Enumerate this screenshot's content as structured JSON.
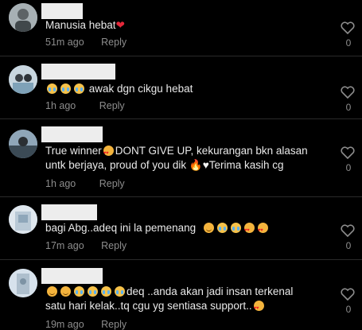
{
  "comments": [
    {
      "segments": [
        {
          "type": "text",
          "value": "Manusia hebat"
        },
        {
          "type": "icon",
          "name": "red-heart-icon"
        }
      ],
      "time": "51m ago",
      "reply": "Reply",
      "likes": "0"
    },
    {
      "segments": [
        {
          "type": "icon",
          "name": "crying-face-icon"
        },
        {
          "type": "icon",
          "name": "crying-face-icon"
        },
        {
          "type": "icon",
          "name": "crying-face-icon"
        },
        {
          "type": "text",
          "value": " awak dgn cikgu hebat"
        }
      ],
      "time": "1h ago",
      "reply": "Reply",
      "likes": "0"
    },
    {
      "lines": [
        "True winner",
        "DONT GIVE UP, kekurangan bkn alasan",
        "untk berjaya, proud of you dik",
        "Terima kasih cg"
      ],
      "time": "1h ago",
      "reply": "Reply",
      "likes": "0"
    },
    {
      "text": "bagi Abg..adeq ini la pemenang",
      "time": "17m ago",
      "reply": "Reply",
      "likes": "0"
    },
    {
      "line1": "deq ..anda akan jadi insan terkenal",
      "line2": "satu hari kelak..tq cgu yg sentiasa support..",
      "time": "19m ago",
      "reply": "Reply",
      "likes": "0"
    }
  ],
  "colors": {
    "background": "#000000",
    "text": "#e9e9e9",
    "muted": "#8d8d8d",
    "heart": "#e5283a"
  }
}
